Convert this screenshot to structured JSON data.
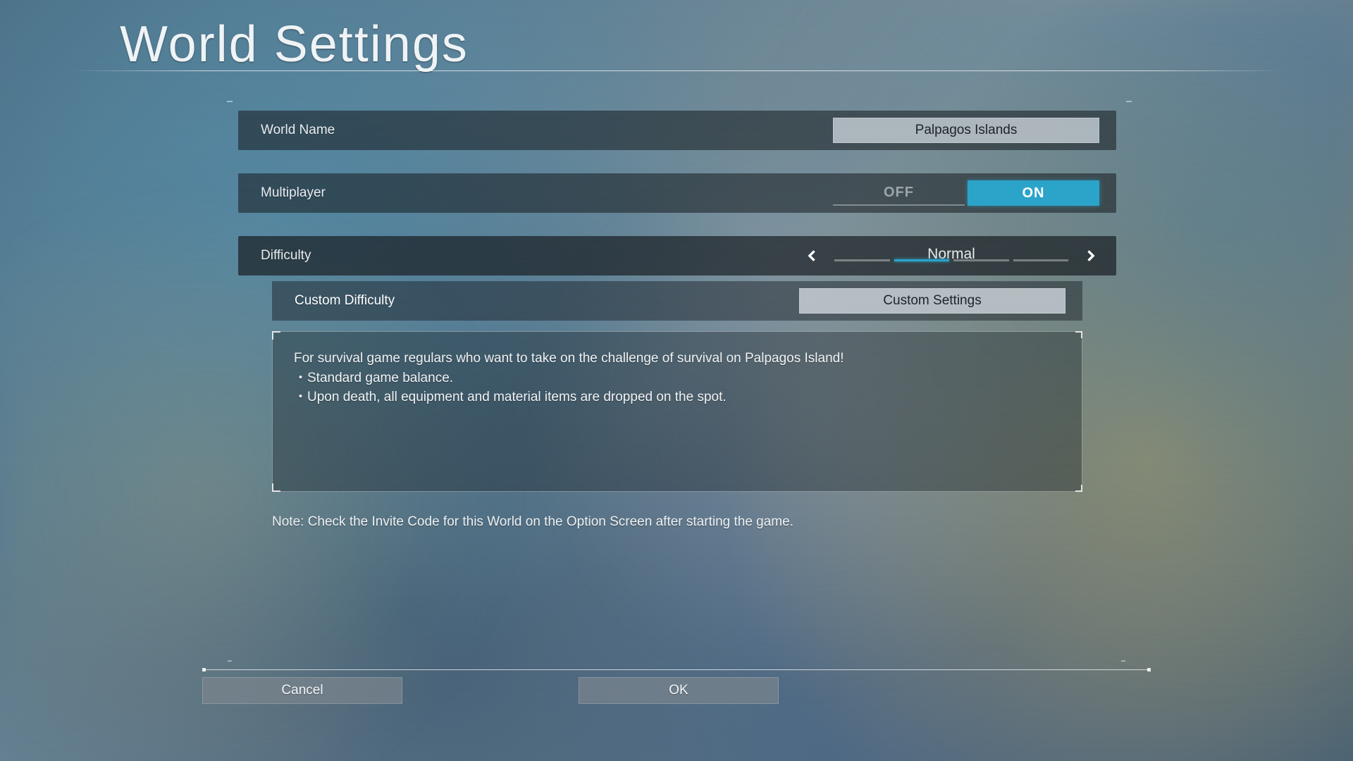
{
  "title": "World Settings",
  "rows": {
    "world_name": {
      "label": "World Name",
      "value": "Palpagos Islands"
    },
    "multiplayer": {
      "label": "Multiplayer",
      "off": "OFF",
      "on": "ON",
      "selected": "ON"
    },
    "difficulty": {
      "label": "Difficulty",
      "value": "Normal",
      "tick_count": 4,
      "active_tick_index": 1
    },
    "custom_difficulty": {
      "label": "Custom Difficulty",
      "button": "Custom Settings"
    }
  },
  "description": {
    "line1": "For survival game regulars who want to take on the challenge of survival on Palpagos Island!",
    "line2": "・Standard game balance.",
    "line3": "・Upon death, all equipment and material items are dropped on the spot."
  },
  "note": "Note: Check the Invite Code for this World on the Option Screen after starting the game.",
  "footer": {
    "cancel": "Cancel",
    "ok": "OK"
  }
}
